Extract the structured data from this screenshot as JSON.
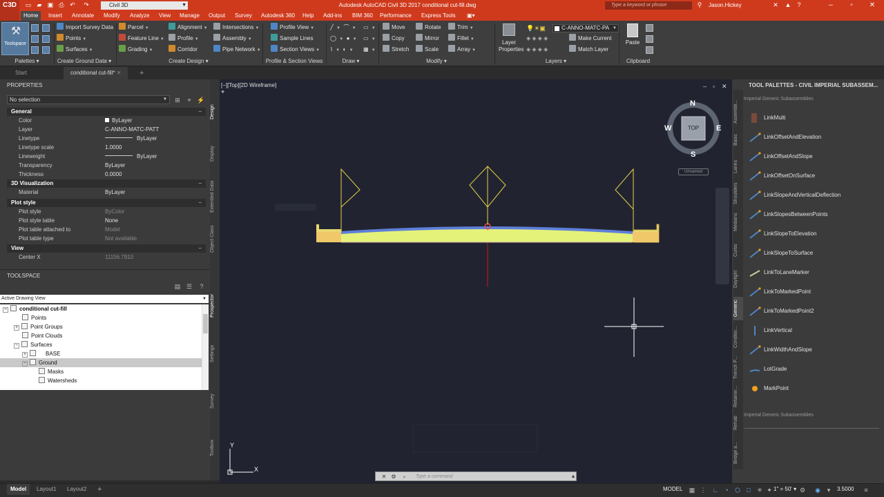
{
  "titlebar": {
    "logo": "C3D",
    "workspace": "Civil 3D",
    "title": "Autodesk AutoCAD Civil 3D 2017    conditional cut-fill.dwg",
    "search_placeholder": "Type a keyword or phrase",
    "user": "Jason.Hickey"
  },
  "menus": [
    "Home",
    "Insert",
    "Annotate",
    "Modify",
    "Analyze",
    "View",
    "Manage",
    "Output",
    "Survey",
    "Autodesk 360",
    "Help",
    "Add-ins",
    "BIM 360",
    "Performance",
    "Express Tools"
  ],
  "ribbon": {
    "toolspace": "Toolspace",
    "palettes_title": "Palettes",
    "create_ground_data": {
      "title": "Create Ground Data",
      "items": [
        "Import Survey Data",
        "Points",
        "Surfaces"
      ]
    },
    "create_design": {
      "title": "Create Design",
      "items": [
        "Parcel",
        "Feature Line",
        "Grading",
        "Alignment",
        "Profile",
        "Corridor",
        "Intersections",
        "Assembly",
        "Pipe Network"
      ]
    },
    "profile_section": {
      "title": "Profile & Section Views",
      "items": [
        "Profile View",
        "Sample Lines",
        "Section Views"
      ]
    },
    "draw": {
      "title": "Draw"
    },
    "modify": {
      "title": "Modify",
      "items": [
        "Move",
        "Copy",
        "Stretch",
        "Rotate",
        "Mirror",
        "Scale",
        "Trim",
        "Fillet",
        "Array"
      ]
    },
    "layers": {
      "title": "Layers",
      "layer_properties": "Layer Properties",
      "current_layer": "C-ANNO-MATC-PA",
      "make_current": "Make Current",
      "match_layer": "Match Layer"
    },
    "clipboard": {
      "title": "Clipboard",
      "paste": "Paste"
    }
  },
  "file_tabs": [
    "Start",
    "conditional cut-fill*"
  ],
  "properties": {
    "title": "PROPERTIES",
    "selection": "No selection",
    "groups": [
      {
        "name": "General",
        "rows": [
          {
            "label": "Color",
            "value": "ByLayer"
          },
          {
            "label": "Layer",
            "value": "C-ANNO-MATC-PATT"
          },
          {
            "label": "Linetype",
            "value": "ByLayer"
          },
          {
            "label": "Linetype scale",
            "value": "1.0000"
          },
          {
            "label": "Lineweight",
            "value": "ByLayer"
          },
          {
            "label": "Transparency",
            "value": "ByLayer"
          },
          {
            "label": "Thickness",
            "value": "0.0000"
          }
        ]
      },
      {
        "name": "3D Visualization",
        "rows": [
          {
            "label": "Material",
            "value": "ByLayer"
          }
        ]
      },
      {
        "name": "Plot style",
        "rows": [
          {
            "label": "Plot style",
            "value": "ByColor"
          },
          {
            "label": "Plot style table",
            "value": "None"
          },
          {
            "label": "Plot table attached to",
            "value": "Model"
          },
          {
            "label": "Plot table type",
            "value": "Not available"
          }
        ]
      },
      {
        "name": "View",
        "rows": [
          {
            "label": "Center X",
            "value": "11156.7910"
          }
        ]
      }
    ],
    "side_tabs": [
      "Design",
      "Display",
      "Extended Data",
      "Object Class"
    ]
  },
  "toolspace": {
    "title": "TOOLSPACE",
    "view": "Active Drawing View",
    "tree": [
      "conditional cut-fill",
      "Points",
      "Point Groups",
      "Point Clouds",
      "Surfaces",
      "BASE",
      "Ground",
      "Masks",
      "Watersheds"
    ],
    "side_tabs": [
      "Prospector",
      "Settings",
      "Survey",
      "Toolbox"
    ]
  },
  "viewport": {
    "label": "[−][Top][2D Wireframe]",
    "compass": {
      "n": "N",
      "s": "S",
      "e": "E",
      "w": "W",
      "top": "TOP"
    },
    "ucs": "Unnamed",
    "axis_x": "X",
    "axis_y": "Y"
  },
  "command": {
    "placeholder": "Type a command"
  },
  "tool_palettes": {
    "title": "TOOL PALETTES - CIVIL IMPERIAL SUBASSEM...",
    "header": "Imperial Generic Subassemblies",
    "footer": "Imperial Generic Subassemblies",
    "items": [
      "LinkMulti",
      "LinkOffsetAndElevation",
      "LinkOffsetAndSlope",
      "LinkOffsetOnSurface",
      "LinkSlopeAndVerticalDeflection",
      "LinkSlopesBetweenPoints",
      "LinkSlopeToElevation",
      "LinkSlopeToSurface",
      "LinkToLaneMarker",
      "LinkToMarkedPoint",
      "LinkToMarkedPoint2",
      "LinkVertical",
      "LinkWidthAndSlope",
      "LotGrade",
      "MarkPoint"
    ],
    "tabs": [
      "Assembli...",
      "Basic",
      "Lanes",
      "Shoulders",
      "Medians",
      "Curbs",
      "Daylight",
      "Generic",
      "Conditio...",
      "Trench P...",
      "Retainin...",
      "Rehab",
      "Bridge a..."
    ],
    "active_tab": "Generic"
  },
  "status": {
    "tabs": [
      "Model",
      "Layout1",
      "Layout2"
    ],
    "model_space": "MODEL",
    "scale": "1\" = 50'",
    "elevation": "3.5000"
  }
}
